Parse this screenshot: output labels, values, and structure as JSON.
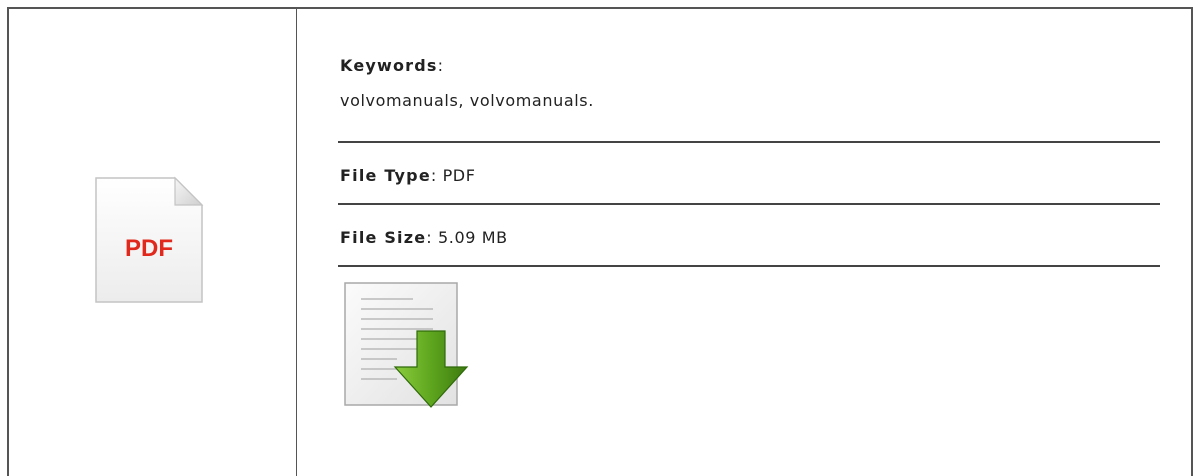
{
  "keywords": {
    "label": "Keywords",
    "separator": ":",
    "value": "volvomanuals, volvomanuals."
  },
  "file_type": {
    "label": "File Type",
    "separator": ":",
    "value": "PDF"
  },
  "file_size": {
    "label": "File Size",
    "separator": ":",
    "value": "5.09 MB"
  },
  "pdf_icon": {
    "text": "PDF",
    "icon": "pdf-file-icon",
    "text_color": "#e0291c"
  },
  "download_icon": {
    "icon": "document-download-icon",
    "arrow_color": "#4e9a06"
  }
}
